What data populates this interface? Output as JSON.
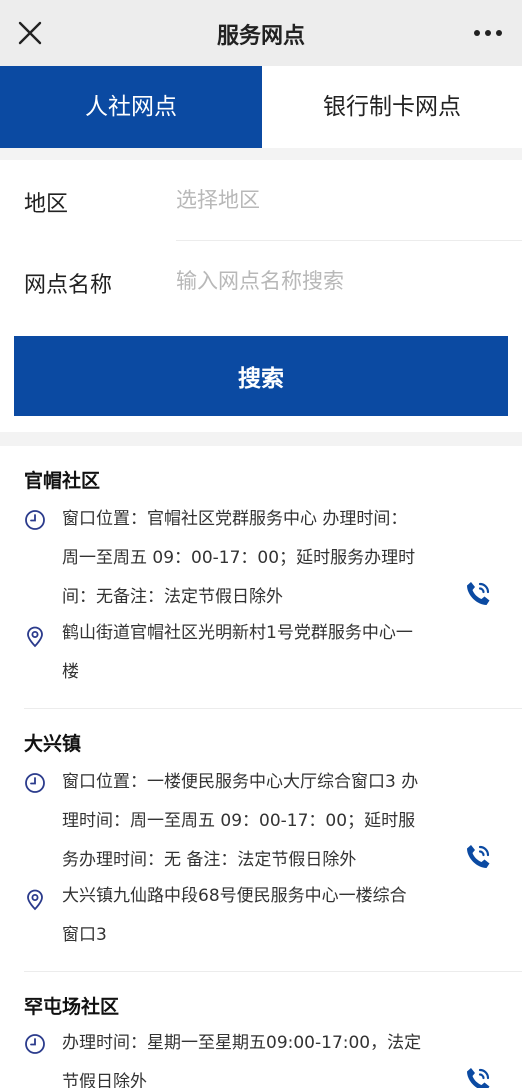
{
  "navbar": {
    "title": "服务网点",
    "close_icon": "close-icon",
    "more_icon": "more-dots-icon"
  },
  "tabs": [
    {
      "label": "人社网点",
      "active": true
    },
    {
      "label": "银行制卡网点",
      "active": false
    }
  ],
  "form": {
    "region": {
      "label": "地区",
      "placeholder": "选择地区",
      "value": ""
    },
    "site_name": {
      "label": "网点名称",
      "placeholder": "输入网点名称搜索",
      "value": ""
    },
    "search_label": "搜索"
  },
  "sites": [
    {
      "name": "官帽社区",
      "info_lines": [
        "窗口位置：官帽社区党群服务中心 办理时间：",
        "周一至周五 09：00-17：00；延时服务办理时",
        "间：无备注：法定节假日除外"
      ],
      "address_lines": [
        "鹤山街道官帽社区光明新村1号党群服务中心一",
        "楼"
      ]
    },
    {
      "name": "大兴镇",
      "info_lines": [
        "窗口位置：一楼便民服务中心大厅综合窗口3 办",
        "理时间：周一至周五 09：00-17：00；延时服",
        "务办理时间：无 备注：法定节假日除外"
      ],
      "address_lines": [
        "大兴镇九仙路中段68号便民服务中心一楼综合",
        "窗口3"
      ]
    },
    {
      "name": "罕屯场社区",
      "info_lines": [
        "办理时间：星期一至星期五09:00-17:00，法定",
        "节假日除外"
      ],
      "address_lines": []
    }
  ],
  "colors": {
    "primary": "#0b4aa2",
    "page_gap": "#f3f3f3"
  },
  "icons": {
    "clock": "clock-icon",
    "location": "location-pin-icon",
    "phone": "phone-icon"
  }
}
